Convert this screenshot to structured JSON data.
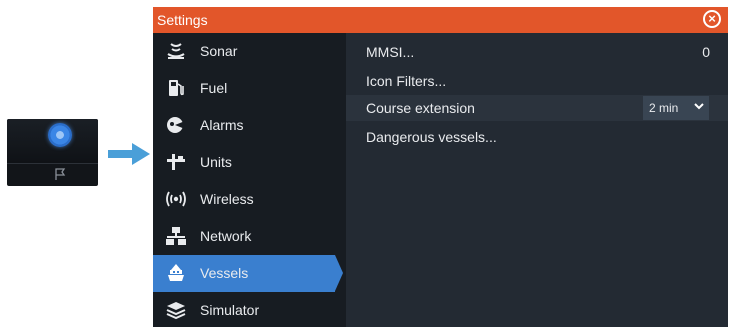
{
  "window": {
    "title": "Settings"
  },
  "sidebar": {
    "items": [
      {
        "label": "Sonar",
        "icon": "sonar-icon"
      },
      {
        "label": "Fuel",
        "icon": "fuel-icon"
      },
      {
        "label": "Alarms",
        "icon": "alarm-icon"
      },
      {
        "label": "Units",
        "icon": "units-icon"
      },
      {
        "label": "Wireless",
        "icon": "wireless-icon"
      },
      {
        "label": "Network",
        "icon": "network-icon"
      },
      {
        "label": "Vessels",
        "icon": "vessel-icon",
        "active": true
      },
      {
        "label": "Simulator",
        "icon": "simulator-icon"
      }
    ]
  },
  "main": {
    "mmsi": {
      "label": "MMSI...",
      "value": "0"
    },
    "icon_filters": {
      "label": "Icon Filters..."
    },
    "course_extension": {
      "label": "Course extension",
      "value": "2 min"
    },
    "dangerous_vessels": {
      "label": "Dangerous vessels..."
    }
  },
  "colors": {
    "titlebar": "#e2562a",
    "sidebar_bg": "#171c22",
    "panel_bg": "#232a33",
    "active": "#3a7fcf",
    "arrow": "#4a9fd8"
  }
}
